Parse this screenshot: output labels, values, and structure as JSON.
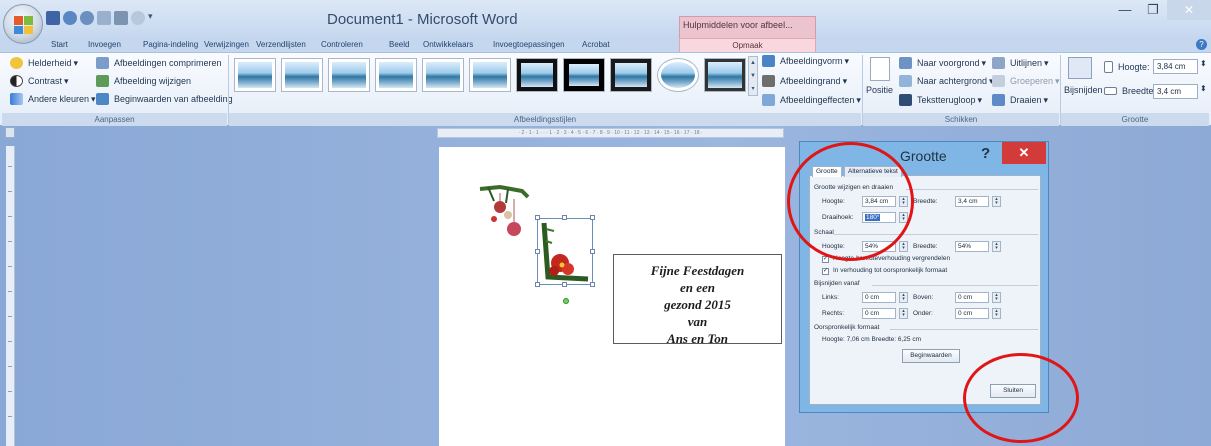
{
  "title_bar": {
    "document_title": "Document1 - Microsoft Word",
    "contextual_tab_group": "Hulpmiddelen voor afbeel..."
  },
  "tabs": [
    "Start",
    "Invoegen",
    "Pagina-indeling",
    "Verwijzingen",
    "Verzendlijsten",
    "Controleren",
    "Beeld",
    "Ontwikkelaars",
    "Invoegtoepassingen",
    "Acrobat",
    "Opmaak"
  ],
  "ribbon": {
    "aanpassen": {
      "helderheid": "Helderheid",
      "contrast": "Contrast",
      "andere_kleuren": "Andere kleuren",
      "comprimeren": "Afbeeldingen comprimeren",
      "wijzigen": "Afbeelding wijzigen",
      "beginwaarden": "Beginwaarden van afbeelding",
      "label": "Aanpassen"
    },
    "stijlen": {
      "vorm": "Afbeeldingvorm",
      "rand": "Afbeeldingrand",
      "effecten": "Afbeeldingeffecten",
      "label": "Afbeeldingsstijlen"
    },
    "schikken": {
      "positie": "Positie",
      "voorgrond": "Naar voorgrond",
      "achtergrond": "Naar achtergrond",
      "tekstterugloop": "Tekstterugloop",
      "uitlijnen": "Uitlijnen",
      "groeperen": "Groeperen",
      "draaien": "Draaien",
      "label": "Schikken"
    },
    "grootte": {
      "bijsnijden": "Bijsnijden",
      "hoogte_label": "Hoogte:",
      "hoogte_value": "3,84 cm",
      "breedte_label": "Breedte:",
      "breedte_value": "3,4 cm",
      "label": "Grootte"
    }
  },
  "card": {
    "line1": "Fijne Feestdagen",
    "line2": "en een",
    "line3": "gezond 2015",
    "line4": "van",
    "line5": "Ans en Ton"
  },
  "dialog": {
    "title": "Grootte",
    "help": "?",
    "close": "✕",
    "tab_grootte": "Grootte",
    "tab_alt": "Alternatieve tekst",
    "section1": "Grootte wijzigen en draaien",
    "hoogte_label": "Hoogte:",
    "hoogte_value": "3,84 cm",
    "breedte_label": "Breedte:",
    "breedte_value": "3,4 cm",
    "draaihoek_label": "Draaihoek:",
    "draaihoek_value": "180°",
    "section2": "Schaal",
    "schaal_hoogte_label": "Hoogte:",
    "schaal_hoogte_value": "54%",
    "schaal_breedte_label": "Breedte:",
    "schaal_breedte_value": "54%",
    "check1": "Hoogte-breedteverhouding vergrendelen",
    "check2": "In verhouding tot oorspronkelijk formaat",
    "section3": "Bijsnijden vanaf",
    "links_label": "Links:",
    "links_value": "0 cm",
    "boven_label": "Boven:",
    "boven_value": "0 cm",
    "rechts_label": "Rechts:",
    "rechts_value": "0 cm",
    "onder_label": "Onder:",
    "onder_value": "0 cm",
    "section4": "Oorspronkelijk formaat",
    "original_size": "Hoogte:   7,06 cm   Breedte:   6,25 cm",
    "reset": "Beginwaarden",
    "close_button": "Sluiten"
  }
}
